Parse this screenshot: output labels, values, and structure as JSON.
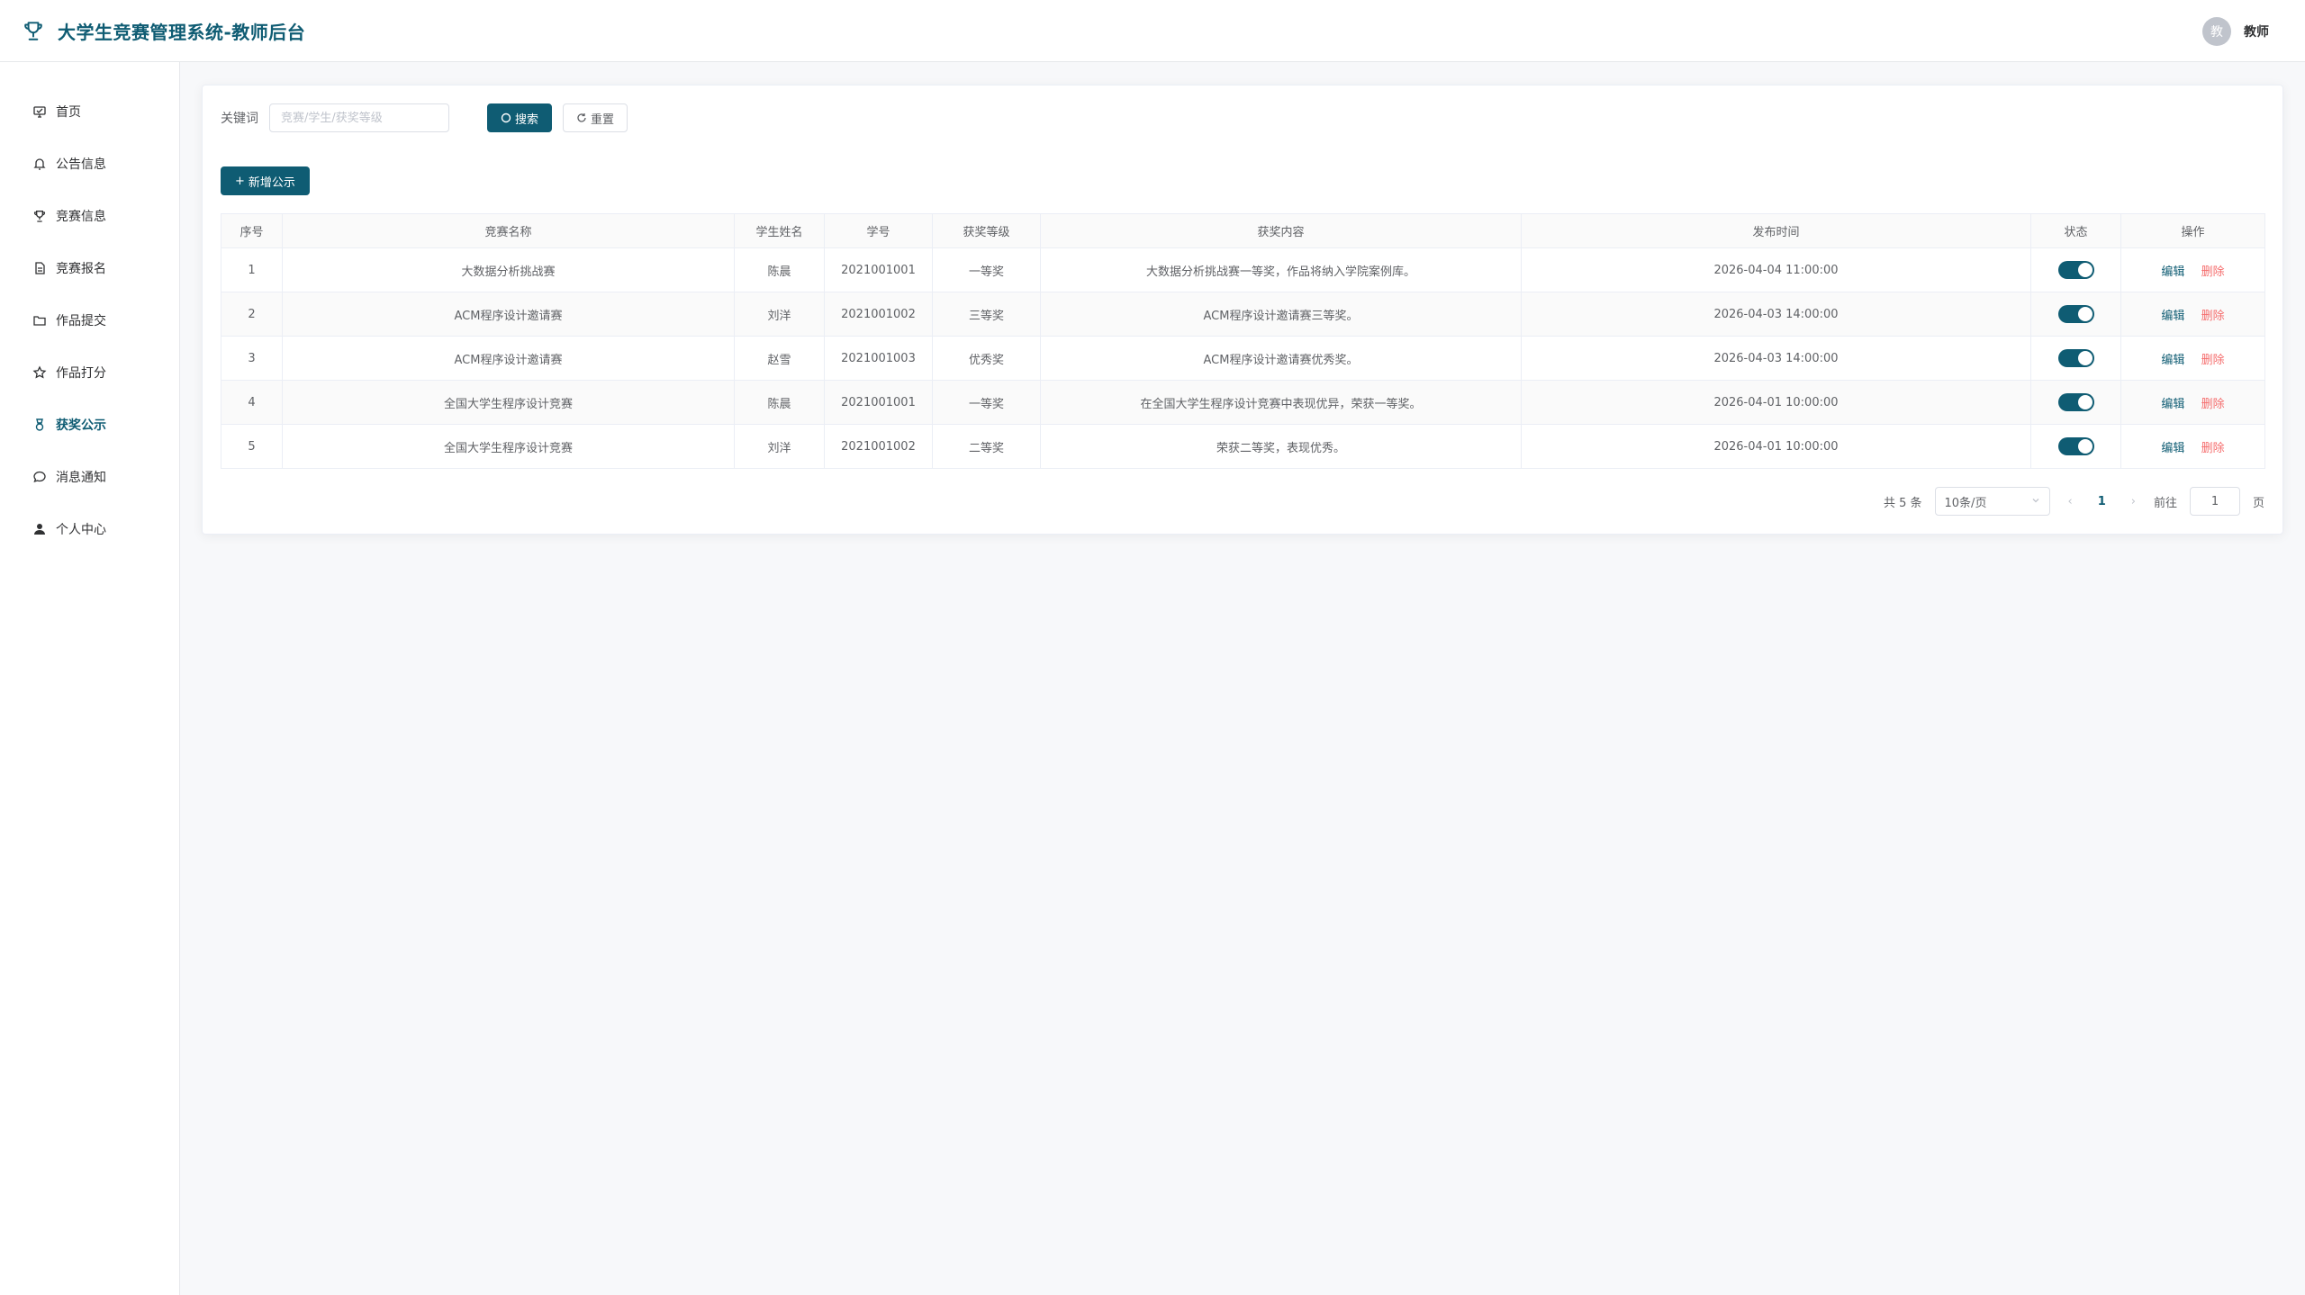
{
  "header": {
    "title": "大学生竞赛管理系统-教师后台",
    "avatar_text": "教",
    "user_name": "教师",
    "brand_icon": "trophy-icon",
    "accent": "#0f5c73"
  },
  "sidebar": {
    "items": [
      {
        "label": "首页",
        "icon": "home-icon"
      },
      {
        "label": "公告信息",
        "icon": "bell-icon"
      },
      {
        "label": "竞赛信息",
        "icon": "trophy-icon"
      },
      {
        "label": "竞赛报名",
        "icon": "document-icon"
      },
      {
        "label": "作品提交",
        "icon": "folder-icon"
      },
      {
        "label": "作品打分",
        "icon": "star-icon"
      },
      {
        "label": "获奖公示",
        "icon": "medal-icon",
        "active": true
      },
      {
        "label": "消息通知",
        "icon": "chat-icon"
      },
      {
        "label": "个人中心",
        "icon": "user-icon"
      }
    ]
  },
  "search": {
    "label": "关键词",
    "placeholder": "竞赛/学生/获奖等级",
    "value": "",
    "search_label": "搜索",
    "reset_label": "重置"
  },
  "toolbar": {
    "add_label": "新增公示"
  },
  "table": {
    "headers": [
      "序号",
      "竞赛名称",
      "学生姓名",
      "学号",
      "获奖等级",
      "获奖内容",
      "发布时间",
      "状态",
      "操作"
    ],
    "rows": [
      {
        "no": "1",
        "competition": "大数据分析挑战赛",
        "student": "陈晨",
        "student_id": "2021001001",
        "level": "一等奖",
        "content": "大数据分析挑战赛一等奖，作品将纳入学院案例库。",
        "time": "2026-04-04 11:00:00",
        "enabled": true
      },
      {
        "no": "2",
        "competition": "ACM程序设计邀请赛",
        "student": "刘洋",
        "student_id": "2021001002",
        "level": "三等奖",
        "content": "ACM程序设计邀请赛三等奖。",
        "time": "2026-04-03 14:00:00",
        "enabled": true
      },
      {
        "no": "3",
        "competition": "ACM程序设计邀请赛",
        "student": "赵雪",
        "student_id": "2021001003",
        "level": "优秀奖",
        "content": "ACM程序设计邀请赛优秀奖。",
        "time": "2026-04-03 14:00:00",
        "enabled": true
      },
      {
        "no": "4",
        "competition": "全国大学生程序设计竞赛",
        "student": "陈晨",
        "student_id": "2021001001",
        "level": "一等奖",
        "content": "在全国大学生程序设计竞赛中表现优异，荣获一等奖。",
        "time": "2026-04-01 10:00:00",
        "enabled": true
      },
      {
        "no": "5",
        "competition": "全国大学生程序设计竞赛",
        "student": "刘洋",
        "student_id": "2021001002",
        "level": "二等奖",
        "content": "荣获二等奖，表现优秀。",
        "time": "2026-04-01 10:00:00",
        "enabled": true
      }
    ],
    "edit_label": "编辑",
    "delete_label": "删除"
  },
  "pagination": {
    "total_text": "共 5 条",
    "page_size": "10条/页",
    "current_page": "1",
    "goto_label": "前往",
    "goto_value": "1",
    "page_suffix": "页"
  }
}
